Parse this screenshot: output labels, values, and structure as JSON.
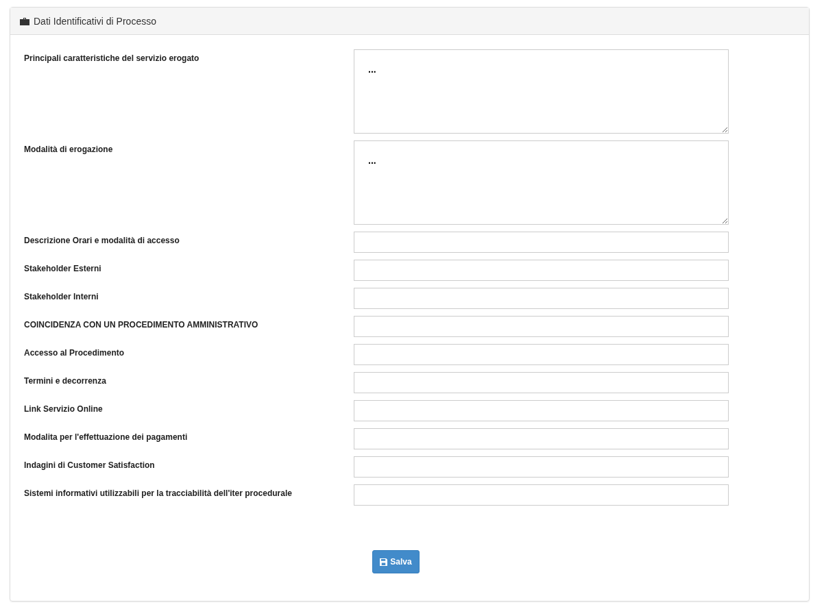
{
  "panel": {
    "title": "Dati Identificativi di Processo"
  },
  "fields": [
    {
      "label": "Principali caratteristiche del servizio erogato",
      "kind": "textarea",
      "value": "..."
    },
    {
      "label": "Modalità di erogazione",
      "kind": "textarea",
      "value": "..."
    },
    {
      "label": "Descrizione Orari e modalità di accesso",
      "kind": "input"
    },
    {
      "label": "Stakeholder Esterni",
      "kind": "input"
    },
    {
      "label": "Stakeholder Interni",
      "kind": "input"
    },
    {
      "label": "COINCIDENZA CON UN PROCEDIMENTO AMMINISTRATIVO",
      "kind": "input"
    },
    {
      "label": "Accesso al Procedimento",
      "kind": "input"
    },
    {
      "label": "Termini e decorrenza",
      "kind": "input"
    },
    {
      "label": "Link Servizio Online",
      "kind": "input"
    },
    {
      "label": "Modalita per l'effettuazione dei pagamenti",
      "kind": "input"
    },
    {
      "label": "Indagini di Customer Satisfaction",
      "kind": "input"
    },
    {
      "label": "Sistemi informativi utilizzabili per la tracciabilità dell'iter procedurale",
      "kind": "input"
    }
  ],
  "save_button": {
    "label": "Salva"
  }
}
